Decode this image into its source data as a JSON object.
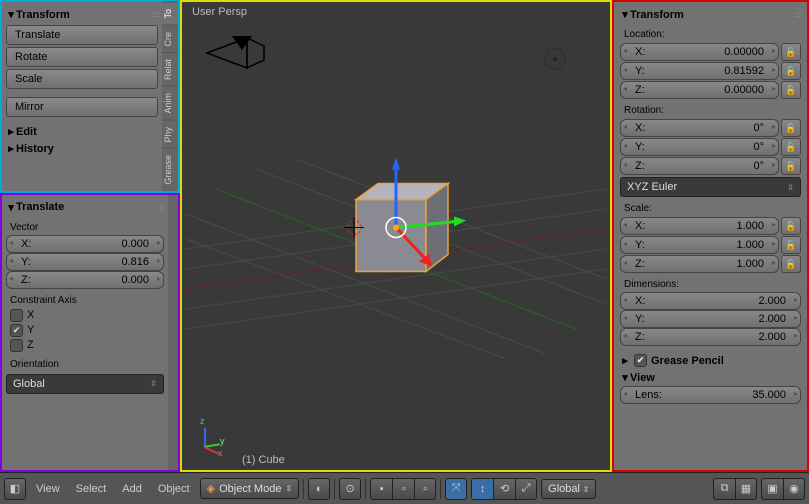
{
  "left_top": {
    "title": "Transform",
    "tabs": [
      "To",
      "Cre",
      "Relat",
      "Anim",
      "Phy",
      "Grease"
    ],
    "buttons": {
      "translate": "Translate",
      "rotate": "Rotate",
      "scale": "Scale",
      "mirror": "Mirror"
    },
    "collapsed": {
      "edit": "Edit",
      "history": "History"
    }
  },
  "left_bottom": {
    "title": "Translate",
    "vector_label": "Vector",
    "vector": {
      "x": {
        "lbl": "X:",
        "val": "0.000"
      },
      "y": {
        "lbl": "Y:",
        "val": "0.816"
      },
      "z": {
        "lbl": "Z:",
        "val": "0.000"
      }
    },
    "constraint_label": "Constraint Axis",
    "constraint": {
      "x": "X",
      "y": "Y",
      "z": "Z"
    },
    "orientation_label": "Orientation",
    "orientation_value": "Global"
  },
  "right": {
    "title": "Transform",
    "location_label": "Location:",
    "location": {
      "x": {
        "lbl": "X:",
        "val": "0.00000"
      },
      "y": {
        "lbl": "Y:",
        "val": "0.81592"
      },
      "z": {
        "lbl": "Z:",
        "val": "0.00000"
      }
    },
    "rotation_label": "Rotation:",
    "rotation": {
      "x": {
        "lbl": "X:",
        "val": "0°"
      },
      "y": {
        "lbl": "Y:",
        "val": "0°"
      },
      "z": {
        "lbl": "Z:",
        "val": "0°"
      }
    },
    "rotation_mode": "XYZ Euler",
    "scale_label": "Scale:",
    "scale": {
      "x": {
        "lbl": "X:",
        "val": "1.000"
      },
      "y": {
        "lbl": "Y:",
        "val": "1.000"
      },
      "z": {
        "lbl": "Z:",
        "val": "1.000"
      }
    },
    "dimensions_label": "Dimensions:",
    "dimensions": {
      "x": {
        "lbl": "X:",
        "val": "2.000"
      },
      "y": {
        "lbl": "Y:",
        "val": "2.000"
      },
      "z": {
        "lbl": "Z:",
        "val": "2.000"
      }
    },
    "grease_label": "Grease Pencil",
    "view_label": "View",
    "lens": {
      "lbl": "Lens:",
      "val": "35.000"
    }
  },
  "viewport": {
    "label": "User Persp",
    "object": "(1) Cube"
  },
  "footer": {
    "menus": {
      "view": "View",
      "select": "Select",
      "add": "Add",
      "object": "Object"
    },
    "mode": "Object Mode",
    "orientation": "Global"
  }
}
